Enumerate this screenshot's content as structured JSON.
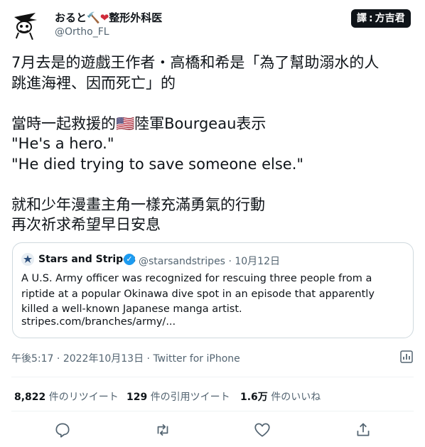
{
  "author": {
    "display_name": "おると",
    "display_suffix": "整形外科医",
    "handle": "@Ortho_FL"
  },
  "translator_badge": {
    "label": "譯",
    "name": "方吉君"
  },
  "tweet": {
    "text": "7月去是的遊戲王作者・高橋和希是「為了幫助溺水的人\n跳進海裡、因而死亡」的\n\n當時一起救援的🇺🇸陸軍Bourgeau表示\n\"He's a hero.\"\n\"He died trying to save someone else.\"\n\n就和少年漫畫主角一樣充滿勇氣的行動\n再次祈求希望早日安息"
  },
  "quote": {
    "name": "Stars and Stripes",
    "handle": "@starsandstripes",
    "separator": "·",
    "date": "10月12日",
    "text": "A U.S. Army officer was recognized for rescuing three people from a riptide at a popular Okinawa dive spot in an episode that apparently killed a well-known Japanese manga artist.",
    "link": "stripes.com/branches/army/..."
  },
  "meta": {
    "time": "午後5:17",
    "date": "2022年10月13日",
    "source": "Twitter for iPhone",
    "sep": "·"
  },
  "stats": {
    "retweets_count": "8,822",
    "retweets_label": "件のリツイート",
    "quotes_count": "129",
    "quotes_label": "件の引用ツイート",
    "likes_count": "1.6万",
    "likes_label": "件のいいね"
  },
  "icons": {
    "reply": "reply-icon",
    "retweet": "retweet-icon",
    "like": "heart-icon",
    "share": "share-icon",
    "analytics": "analytics-icon",
    "verified": "verified-icon"
  },
  "colors": {
    "text": "#0f1419",
    "secondary": "#536471",
    "border": "#cfd9de",
    "verified": "#1d9bf0"
  }
}
